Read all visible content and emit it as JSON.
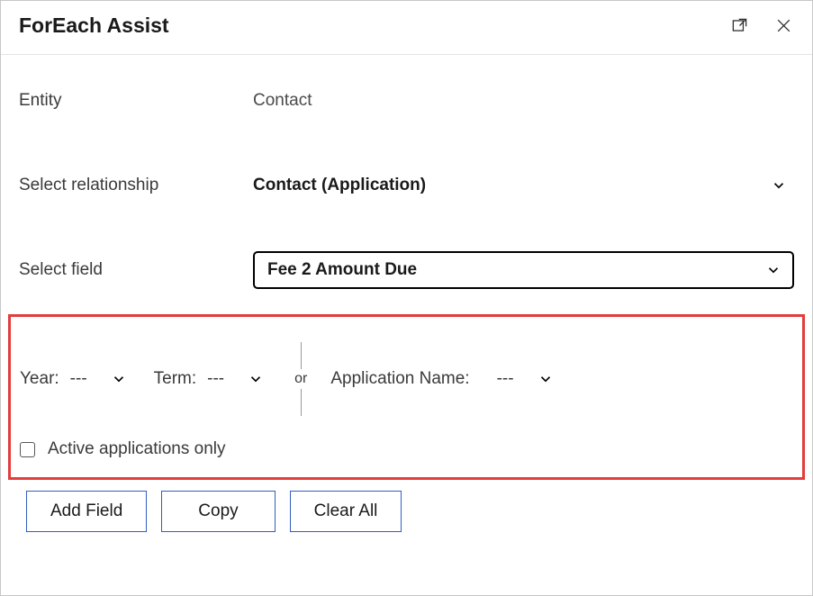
{
  "dialog": {
    "title": "ForEach Assist"
  },
  "form": {
    "entity_label": "Entity",
    "entity_value": "Contact",
    "relationship_label": "Select relationship",
    "relationship_value": "Contact (Application)",
    "field_label": "Select field",
    "field_value": "Fee 2 Amount Due"
  },
  "filters": {
    "year_label": "Year:",
    "year_value": "---",
    "term_label": "Term:",
    "term_value": "---",
    "or_text": "or",
    "appname_label": "Application Name:",
    "appname_value": "---",
    "active_only_label": "Active applications only"
  },
  "buttons": {
    "add_field": "Add Field",
    "copy": "Copy",
    "clear_all": "Clear All"
  }
}
